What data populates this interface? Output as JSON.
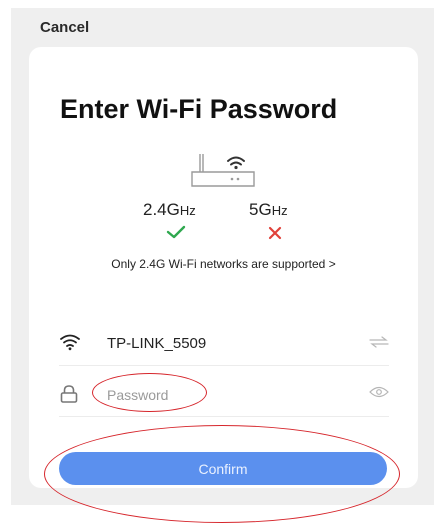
{
  "header": {
    "cancel_label": "Cancel"
  },
  "card": {
    "title": "Enter Wi-Fi Password",
    "bands": [
      {
        "name": "2.4G",
        "unit": "Hz",
        "supported": true,
        "status_color": "#2fa84f"
      },
      {
        "name": "5G",
        "unit": "Hz",
        "supported": false,
        "status_color": "#e0413a"
      }
    ],
    "support_note": "Only 2.4G Wi-Fi networks are supported >",
    "network": {
      "ssid": "TP-LINK_5509"
    },
    "password": {
      "placeholder": "Password",
      "value": ""
    },
    "confirm_label": "Confirm"
  },
  "colors": {
    "accent": "#5b90ee",
    "annotation": "#d6262c"
  }
}
